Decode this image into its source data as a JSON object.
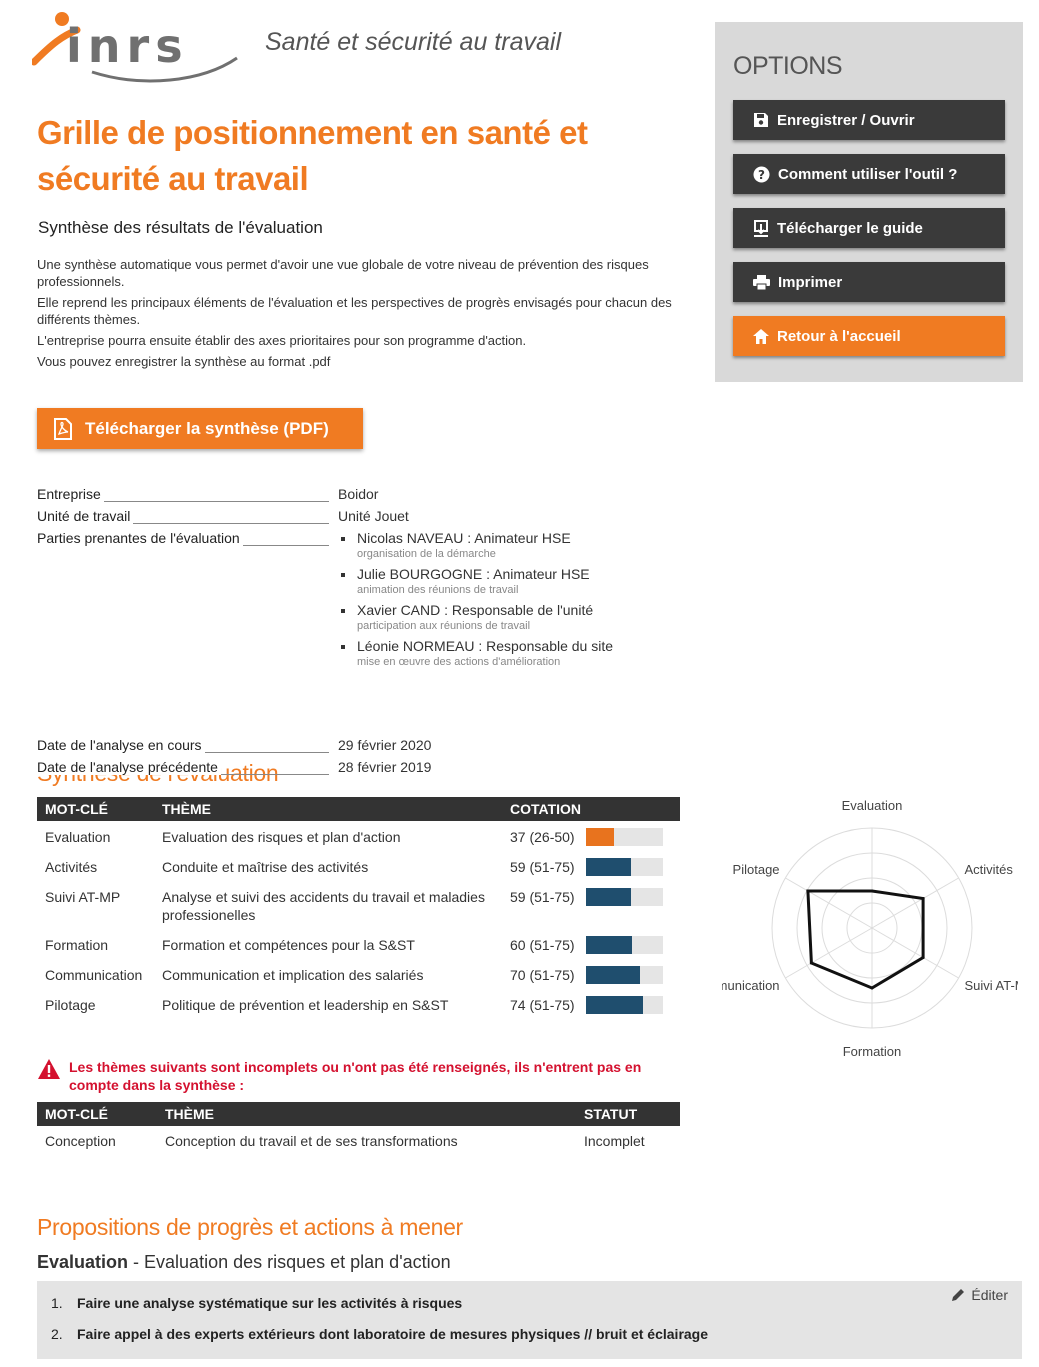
{
  "header": {
    "logo_text": "inrs",
    "tagline": "Santé et sécurité au travail"
  },
  "title": "Grille de positionnement en santé et sécurité au travail",
  "subtitle": "Synthèse des résultats de l'évaluation",
  "intro": [
    "Une synthèse automatique vous permet d'avoir une vue globale de votre niveau de prévention des risques professionnels.",
    "Elle reprend les principaux éléments de l'évaluation et les perspectives de progrès envisagés pour chacun des différents thèmes.",
    "L'entreprise pourra ensuite établir des axes prioritaires pour son programme d'action.",
    "Vous pouvez enregistrer la synthèse au format .pdf"
  ],
  "download_pdf_label": "Télécharger la synthèse (PDF)",
  "meta": {
    "entreprise_label": "Entreprise",
    "entreprise": "Boidor",
    "unite_label": "Unité de travail",
    "unite": "Unité Jouet",
    "parties_label": "Parties prenantes de l'évaluation",
    "parties": [
      {
        "name": "Nicolas NAVEAU  : Animateur HSE",
        "role": "organisation de la démarche"
      },
      {
        "name": "Julie BOURGOGNE : Animateur HSE",
        "role": "animation des réunions de travail"
      },
      {
        "name": "Xavier CAND : Responsable de l'unité",
        "role": "participation aux réunions de travail"
      },
      {
        "name": "Léonie NORMEAU : Responsable du site",
        "role": "mise en œuvre des actions d'amélioration"
      }
    ],
    "date_cours_label": "Date de l'analyse en cours",
    "date_cours": "29 février 2020",
    "date_prec_label": "Date de l'analyse précédente",
    "date_prec": "28 février 2019"
  },
  "synthese": {
    "title": "Synthèse de l'évaluation",
    "headers": [
      "MOT-CLÉ",
      "THÈME",
      "COTATION"
    ],
    "rows": [
      {
        "key": "Evaluation",
        "theme": "Evaluation des risques et plan d'action",
        "cotation": "37 (26-50)",
        "value": 37,
        "color": "#e8731e"
      },
      {
        "key": "Activités",
        "theme": "Conduite et maîtrise des activités",
        "cotation": "59 (51-75)",
        "value": 59,
        "color": "#1f4e6e"
      },
      {
        "key": "Suivi AT-MP",
        "theme": "Analyse et suivi des accidents du travail et maladies professionelles",
        "cotation": "59 (51-75)",
        "value": 59,
        "color": "#1f4e6e"
      },
      {
        "key": "Formation",
        "theme": "Formation et compétences pour la S&ST",
        "cotation": "60 (51-75)",
        "value": 60,
        "color": "#1f4e6e"
      },
      {
        "key": "Communication",
        "theme": "Communication et implication des salariés",
        "cotation": "70 (51-75)",
        "value": 70,
        "color": "#1f4e6e"
      },
      {
        "key": "Pilotage",
        "theme": "Politique de prévention et leadership en S&ST",
        "cotation": "74 (51-75)",
        "value": 74,
        "color": "#1f4e6e"
      }
    ]
  },
  "chart_data": {
    "type": "radar",
    "categories": [
      "Evaluation",
      "Activités",
      "Suivi AT-MP",
      "Formation",
      "Communication",
      "Pilotage"
    ],
    "values": [
      37,
      59,
      59,
      60,
      70,
      74
    ],
    "range": [
      0,
      100
    ],
    "rings": 4,
    "grid": true
  },
  "warning": "Les thèmes suivants sont incomplets ou n'ont pas été renseignés, ils n'entrent pas en compte dans la synthèse :",
  "incomplets": {
    "headers": [
      "MOT-CLÉ",
      "THÈME",
      "STATUT"
    ],
    "rows": [
      {
        "key": "Conception",
        "theme": "Conception du travail et de ses transformations",
        "statut": "Incomplet"
      }
    ]
  },
  "propositions": {
    "title": "Propositions de progrès et actions à mener",
    "sub_key": "Evaluation",
    "sub_sep": " - ",
    "sub_theme": "Evaluation des risques et plan d'action",
    "edit_label": "Éditer",
    "items": [
      {
        "n": "1.",
        "text": "Faire une analyse systématique sur les activités à risques"
      },
      {
        "n": "2.",
        "text": "Faire appel à des experts extérieurs dont laboratoire de mesures physiques // bruit et éclairage"
      }
    ]
  },
  "options": {
    "title": "OPTIONS",
    "buttons": {
      "save": "Enregistrer / Ouvrir",
      "help": "Comment utiliser l'outil ?",
      "guide": "Télécharger le guide",
      "print": "Imprimer",
      "home": "Retour à l'accueil"
    }
  },
  "colors": {
    "accent": "#f07b22",
    "dark": "#333333",
    "bar": "#1f4e6e",
    "warning": "#d4112f"
  }
}
